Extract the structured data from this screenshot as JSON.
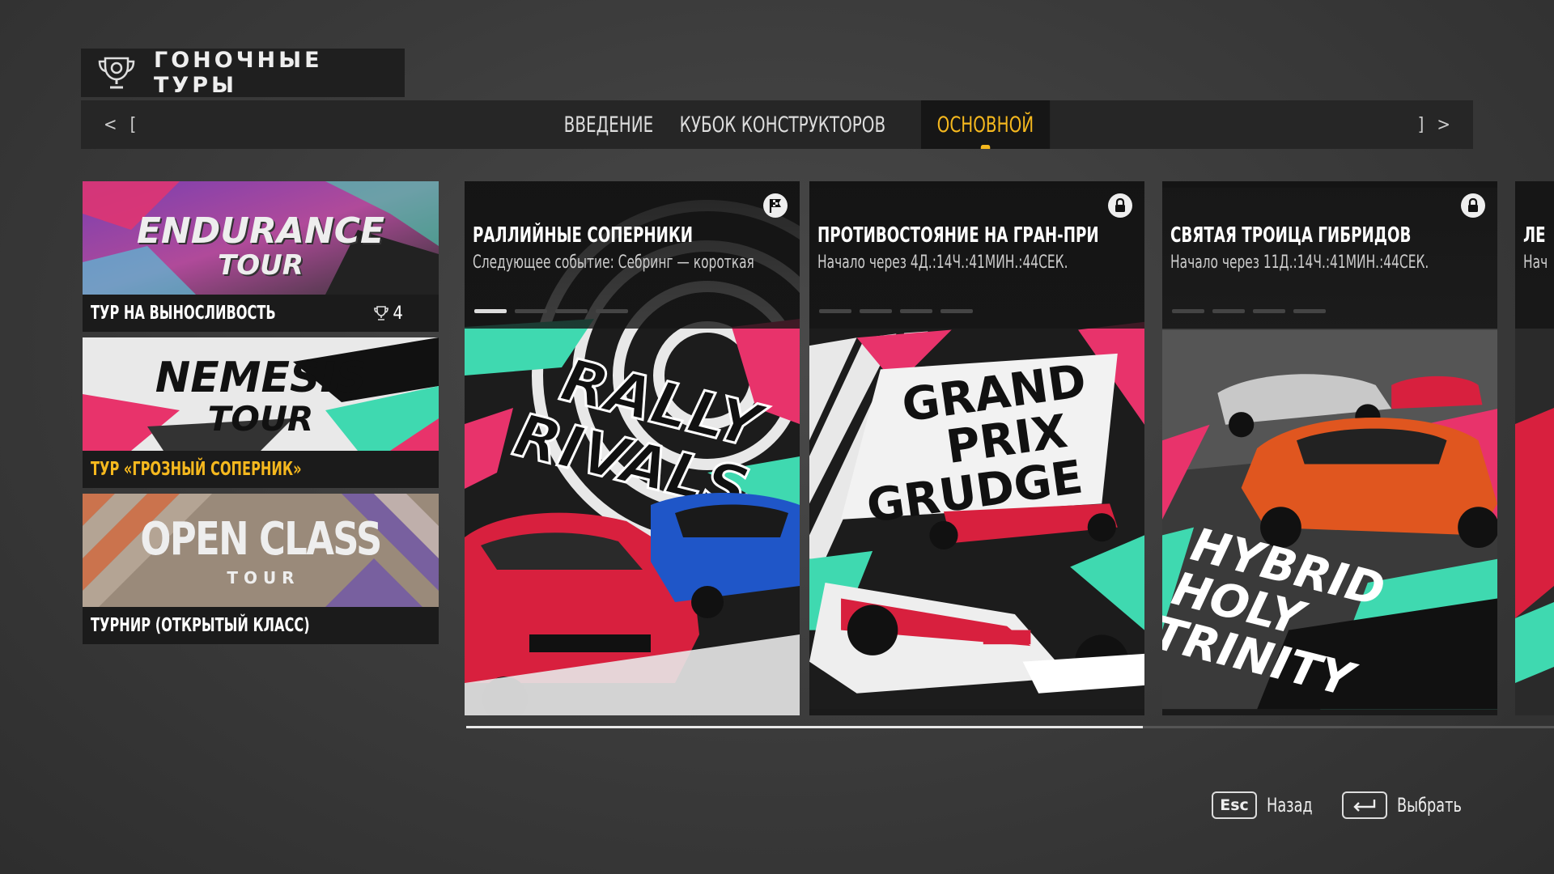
{
  "header": {
    "title": "ГОНОЧНЫЕ ТУРЫ"
  },
  "tabbar": {
    "left_arrow": "<",
    "left_bracket": "[",
    "right_bracket": "]",
    "right_arrow": ">",
    "tabs": [
      {
        "label": "ВВЕДЕНИЕ",
        "active": false
      },
      {
        "label": "КУБОК КОНСТРУКТОРОВ",
        "active": false
      },
      {
        "label": "ОСНОВНОЙ",
        "active": true
      }
    ]
  },
  "tours": [
    {
      "art_line1": "ENDURANCE",
      "art_line2": "TOUR",
      "label": "ТУР НА ВЫНОСЛИВОСТЬ",
      "trophies": "4",
      "selected": false
    },
    {
      "art_line1": "NEMESIS",
      "art_line2": "TOUR",
      "label": "ТУР «ГРОЗНЫЙ СОПЕРНИК»",
      "selected": true
    },
    {
      "art_line1": "OPEN CLASS",
      "art_line2": "T O U R",
      "label": "ТУРНИР (ОТКРЫТЫЙ КЛАСС)",
      "selected": false
    }
  ],
  "events": [
    {
      "title": "РАЛЛИЙНЫЕ СОПЕРНИКИ",
      "subtitle": "Следующее событие: Себринг — короткая",
      "art_text": [
        "RALLY",
        "RIVALS"
      ],
      "icon": "flag-icon",
      "locked": false
    },
    {
      "title": "ПРОТИВОСТОЯНИЕ НА ГРАН-ПРИ",
      "subtitle": "Начало через 4Д.:14Ч.:41МИН.:44СЕК.",
      "art_text": [
        "GRAND",
        "PRIX",
        "GRUDGE"
      ],
      "icon": "lock-icon",
      "locked": true
    },
    {
      "title": "СВЯТАЯ ТРОИЦА ГИБРИДОВ",
      "subtitle": "Начало через 11Д.:14Ч.:41МИН.:44СЕК.",
      "art_text": [
        "HYBRID",
        "HOLY",
        "TRINITY"
      ],
      "icon": "lock-icon",
      "locked": true
    },
    {
      "title": "ЛЕ",
      "subtitle": "Нач"
    }
  ],
  "footer": {
    "back_key": "Esc",
    "back_label": "Назад",
    "select_label": "Выбрать"
  },
  "colors": {
    "accent": "#f5b81e",
    "pink": "#e8336b",
    "teal": "#3fd9b0"
  }
}
